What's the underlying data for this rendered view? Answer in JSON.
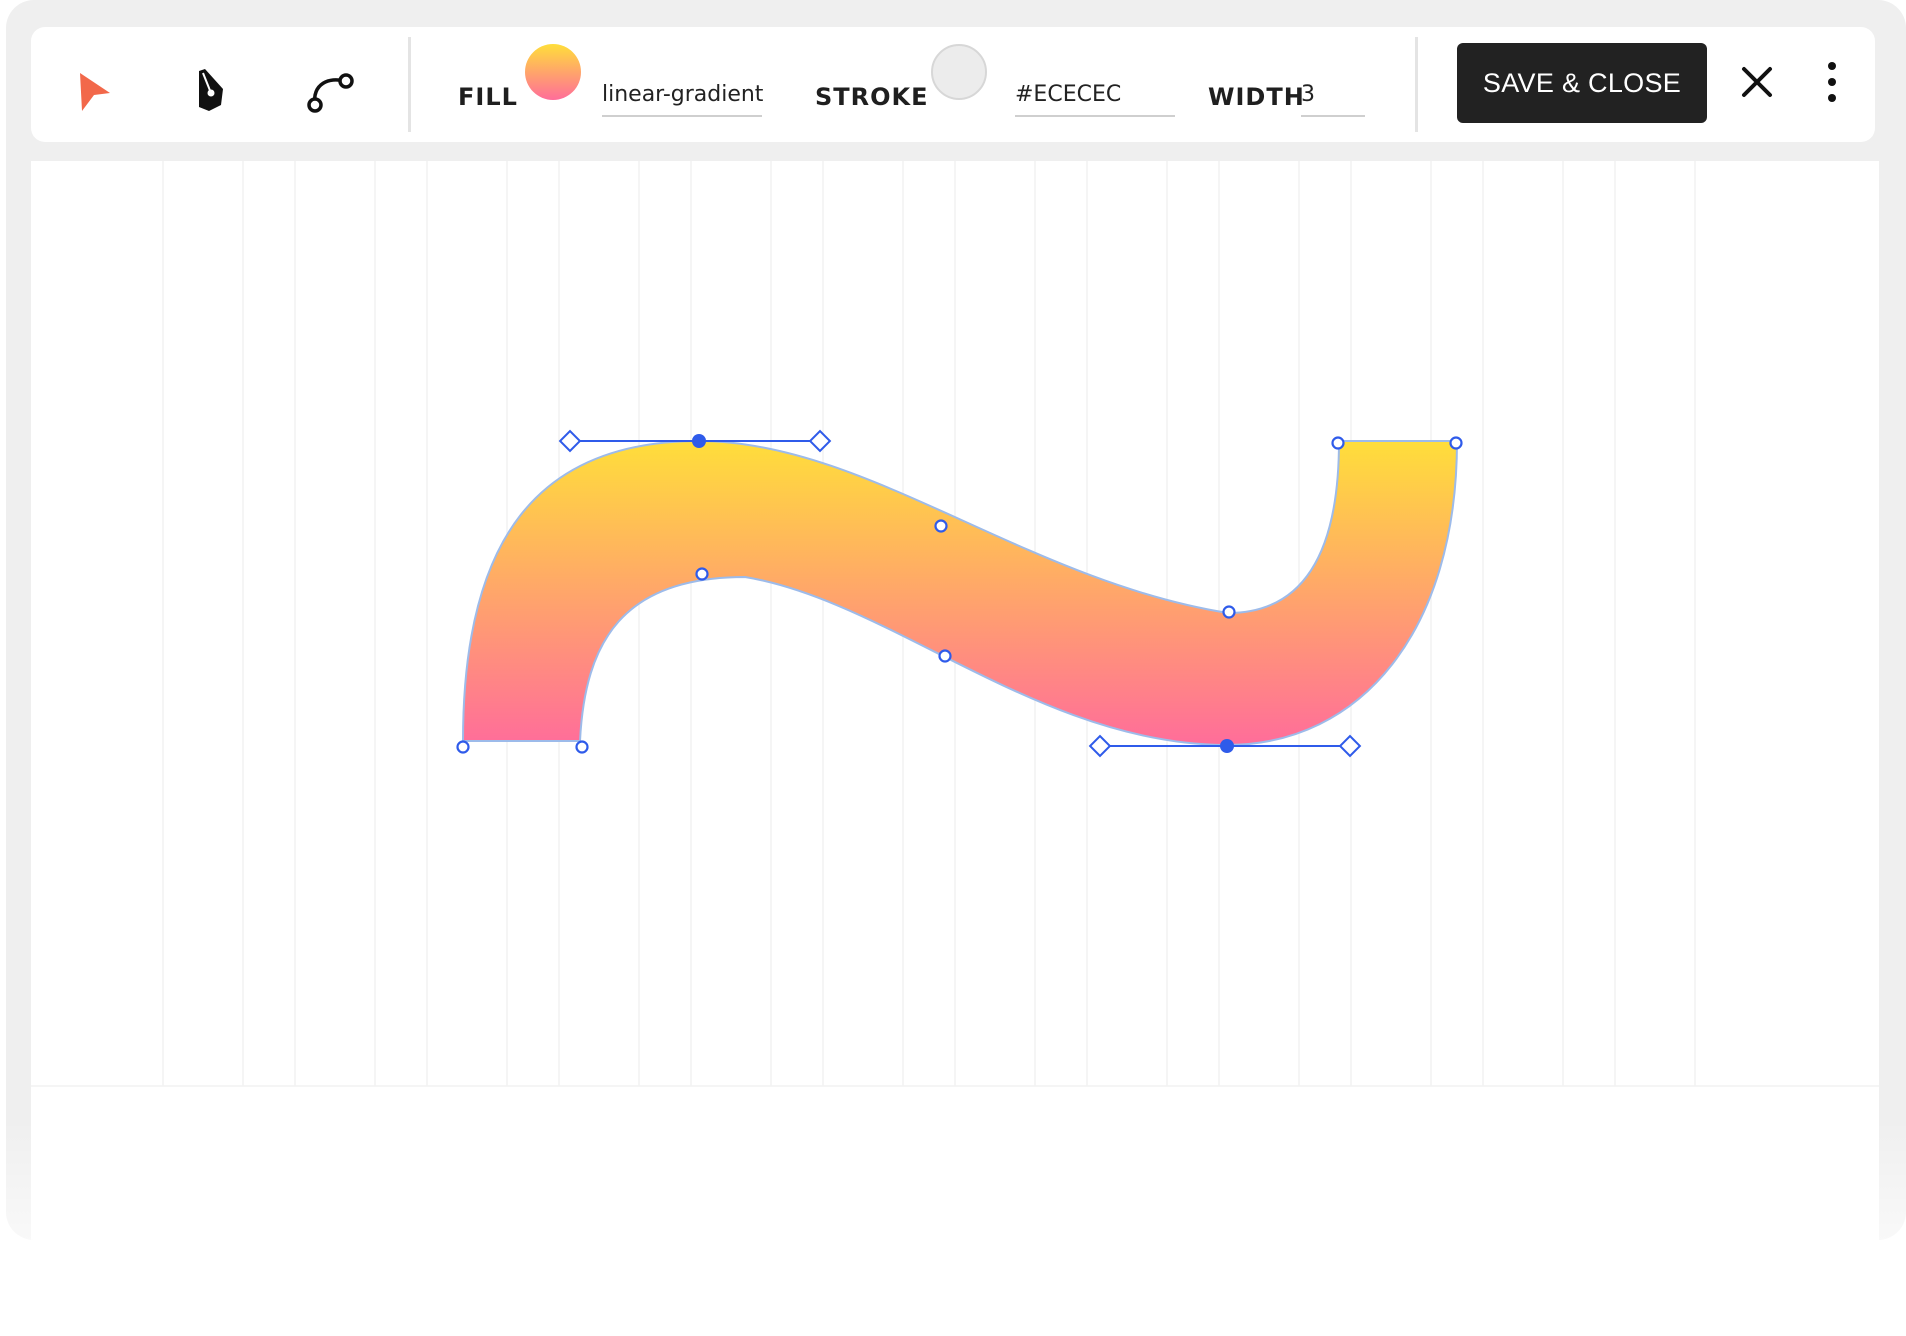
{
  "toolbar": {
    "tools": [
      {
        "name": "select-tool",
        "icon": "cursor-arrow-icon",
        "color": "#F2684A"
      },
      {
        "name": "pen-tool",
        "icon": "pen-nib-icon",
        "color": "#111111"
      },
      {
        "name": "bezier-tool",
        "icon": "bezier-curve-icon",
        "color": "#111111"
      }
    ],
    "fill_label": "FILL",
    "fill_value": "linear-gradient",
    "fill_gradient": {
      "top": "#FFDE3A",
      "bottom": "#FF6D9A"
    },
    "stroke_label": "STROKE",
    "stroke_value": "#ECECEC",
    "stroke_color": "#ECECEC",
    "width_label": "WIDTH",
    "width_value": "3",
    "save_label": "SAVE & CLOSE",
    "close_icon": "close-icon",
    "menu_icon": "more-vertical-icon"
  },
  "canvas": {
    "shape": "s-curve-path",
    "handle_color": "#2F5BEA",
    "outline_color": "#9DBBEA"
  }
}
